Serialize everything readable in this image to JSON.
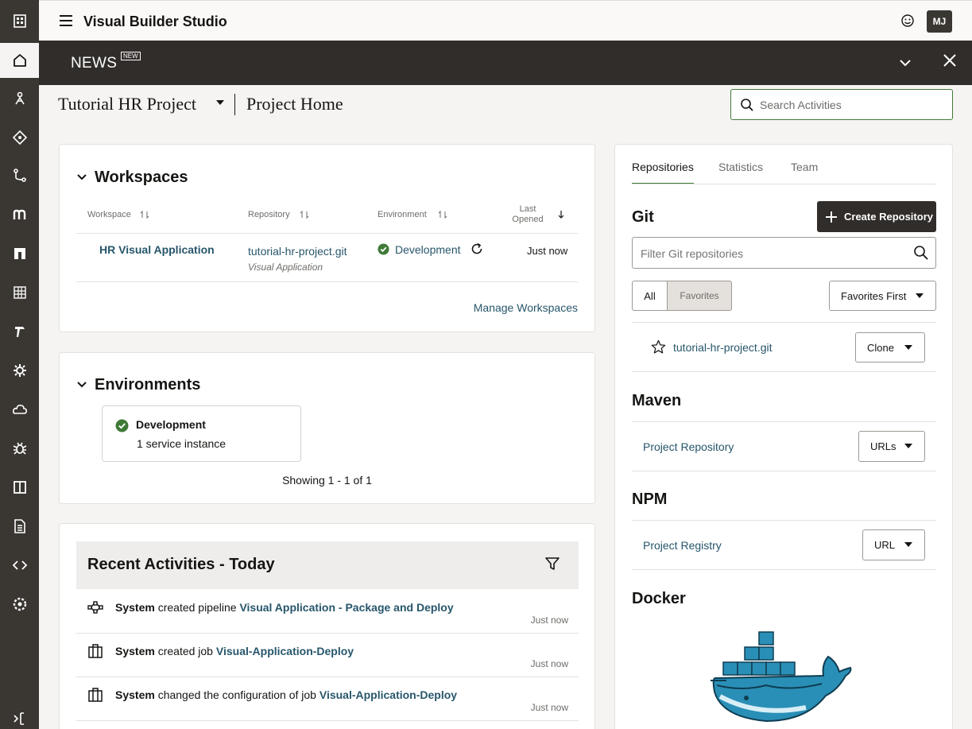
{
  "app": {
    "title": "Visual Builder Studio",
    "user_initials": "MJ"
  },
  "news": {
    "label": "NEWS",
    "badge": "NEW"
  },
  "breadcrumb": {
    "project": "Tutorial HR Project",
    "page": "Project Home"
  },
  "search": {
    "placeholder": "Search Activities"
  },
  "workspaces": {
    "title": "Workspaces",
    "columns": {
      "workspace": "Workspace",
      "repository": "Repository",
      "environment": "Environment",
      "last_opened": "Last Opened"
    },
    "row": {
      "name": "HR Visual Application",
      "repository": "tutorial-hr-project.git",
      "repository_type": "Visual Application",
      "environment": "Development",
      "last_opened": "Just now"
    },
    "manage_link": "Manage Workspaces"
  },
  "environments": {
    "title": "Environments",
    "tile": {
      "name": "Development",
      "detail": "1 service instance"
    },
    "paging": "Showing 1 - 1 of 1"
  },
  "activities": {
    "title": "Recent Activities - Today",
    "items": [
      {
        "actor": "System",
        "action": "created pipeline",
        "target": "Visual Application - Package and Deploy",
        "time": "Just now",
        "icon": "pipeline-icon"
      },
      {
        "actor": "System",
        "action": "created job",
        "target": "Visual-Application-Deploy",
        "time": "Just now",
        "icon": "job-icon"
      },
      {
        "actor": "System",
        "action": "changed the configuration of job",
        "target": "Visual-Application-Deploy",
        "time": "Just now",
        "icon": "job-icon"
      }
    ]
  },
  "right_panel": {
    "tabs": [
      "Repositories",
      "Statistics",
      "Team"
    ],
    "git": {
      "title": "Git",
      "create_button": "Create Repository",
      "filter_placeholder": "Filter Git repositories",
      "toggle_all": "All",
      "toggle_favorites": "Favorites",
      "sort_select": "Favorites First",
      "repo_name": "tutorial-hr-project.git",
      "clone_button": "Clone"
    },
    "maven": {
      "title": "Maven",
      "link": "Project Repository",
      "button": "URLs"
    },
    "npm": {
      "title": "NPM",
      "link": "Project Registry",
      "button": "URL"
    },
    "docker": {
      "title": "Docker"
    }
  },
  "colors": {
    "rail": "#3a3632",
    "news_bar": "#312d2a",
    "link": "#27566b",
    "success": "#3f7a37"
  }
}
